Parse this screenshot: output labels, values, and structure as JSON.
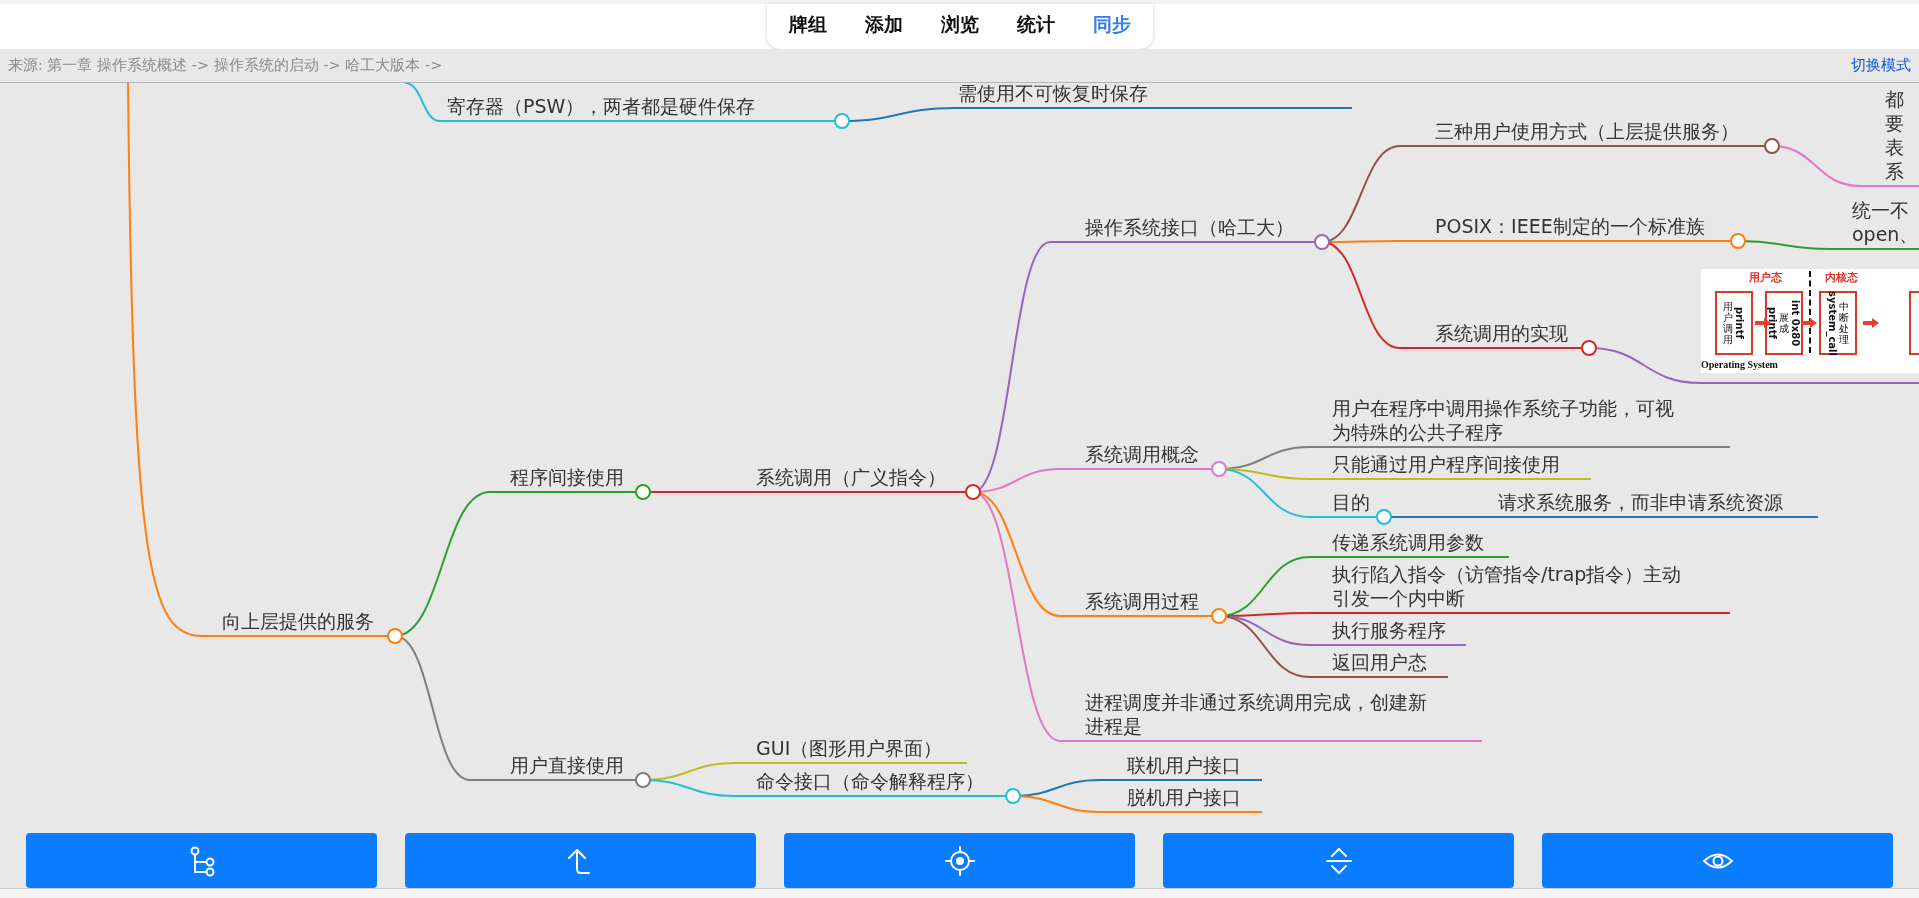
{
  "tabs": [
    {
      "label": "牌组",
      "selected": false
    },
    {
      "label": "添加",
      "selected": false
    },
    {
      "label": "浏览",
      "selected": false
    },
    {
      "label": "统计",
      "selected": false
    },
    {
      "label": "同步",
      "selected": true
    }
  ],
  "breadcrumb": "来源: 第一章 操作系统概述 -> 操作系统的启动 -> 哈工大版本 ->",
  "mode_link": "切换模式",
  "mindmap": {
    "nodes": [
      {
        "kind": "text",
        "lines": [
          "寄存器（PSW），两者都是硬件保存"
        ],
        "children": [
          {
            "kind": "text",
            "lines": [
              "需使用不可恢复时保存"
            ]
          }
        ]
      },
      {
        "kind": "text",
        "lines": [
          "向上层提供的服务"
        ],
        "children": [
          {
            "kind": "text",
            "lines": [
              "程序间接使用"
            ],
            "children": [
              {
                "kind": "text",
                "lines": [
                  "系统调用（广义指令）"
                ],
                "children": [
                  {
                    "kind": "text",
                    "lines": [
                      "操作系统接口（哈工大）"
                    ],
                    "children": [
                      {
                        "kind": "text",
                        "lines": [
                          "三种用户使用方式（上层提供服务）"
                        ],
                        "children": [
                          {
                            "kind": "text",
                            "lines": [
                              "都",
                              "要",
                              "表",
                              "系"
                            ]
                          }
                        ]
                      },
                      {
                        "kind": "text",
                        "lines": [
                          "POSIX：IEEE制定的一个标准族"
                        ],
                        "children": [
                          {
                            "kind": "text",
                            "lines": [
                              "统一不",
                              "open、"
                            ]
                          }
                        ]
                      },
                      {
                        "kind": "text",
                        "lines": [
                          "系统调用的实现"
                        ],
                        "children": [
                          {
                            "kind": "image",
                            "diagram": {
                              "states": [
                                "用户态",
                                "内核态"
                              ],
                              "boxes": [
                                {
                                  "parts": [
                                    {
                                      "kind": "latin",
                                      "text": "printf"
                                    },
                                    {
                                      "kind": "cjk",
                                      "text": "用户调用"
                                    }
                                  ]
                                },
                                {
                                  "parts": [
                                    {
                                      "kind": "latin",
                                      "text": "int 0x80"
                                    },
                                    {
                                      "kind": "cjk",
                                      "text": "展成"
                                    },
                                    {
                                      "kind": "latin",
                                      "text": "printf"
                                    }
                                  ]
                                },
                                {
                                  "parts": [
                                    {
                                      "kind": "cjk",
                                      "text": "中断处理"
                                    },
                                    {
                                      "kind": "latin",
                                      "text": "system_call"
                                    }
                                  ]
                                }
                              ],
                              "caption": "Operating System"
                            }
                          }
                        ]
                      }
                    ]
                  },
                  {
                    "kind": "text",
                    "lines": [
                      "系统调用概念"
                    ],
                    "children": [
                      {
                        "kind": "text",
                        "lines": [
                          "用户在程序中调用操作系统子功能，可视",
                          "为特殊的公共子程序"
                        ]
                      },
                      {
                        "kind": "text",
                        "lines": [
                          "只能通过用户程序间接使用"
                        ]
                      },
                      {
                        "kind": "text",
                        "lines": [
                          "目的"
                        ],
                        "children": [
                          {
                            "kind": "text",
                            "lines": [
                              "请求系统服务，而非申请系统资源"
                            ]
                          }
                        ]
                      }
                    ]
                  },
                  {
                    "kind": "text",
                    "lines": [
                      "系统调用过程"
                    ],
                    "children": [
                      {
                        "kind": "text",
                        "lines": [
                          "传递系统调用参数"
                        ]
                      },
                      {
                        "kind": "text",
                        "lines": [
                          "执行陷入指令（访管指令/trap指令）主动",
                          "引发一个内中断"
                        ]
                      },
                      {
                        "kind": "text",
                        "lines": [
                          "执行服务程序"
                        ]
                      },
                      {
                        "kind": "text",
                        "lines": [
                          "返回用户态"
                        ]
                      }
                    ]
                  },
                  {
                    "kind": "text",
                    "lines": [
                      "进程调度并非通过系统调用完成，创建新",
                      "进程是"
                    ]
                  }
                ]
              }
            ]
          },
          {
            "kind": "text",
            "lines": [
              "用户直接使用"
            ],
            "children": [
              {
                "kind": "text",
                "lines": [
                  "GUI（图形用户界面）"
                ]
              },
              {
                "kind": "text",
                "lines": [
                  "命令接口（命令解释程序）"
                ],
                "children": [
                  {
                    "kind": "text",
                    "lines": [
                      "联机用户接口"
                    ]
                  },
                  {
                    "kind": "text",
                    "lines": [
                      "脱机用户接口"
                    ]
                  }
                ]
              }
            ]
          }
        ]
      }
    ]
  }
}
